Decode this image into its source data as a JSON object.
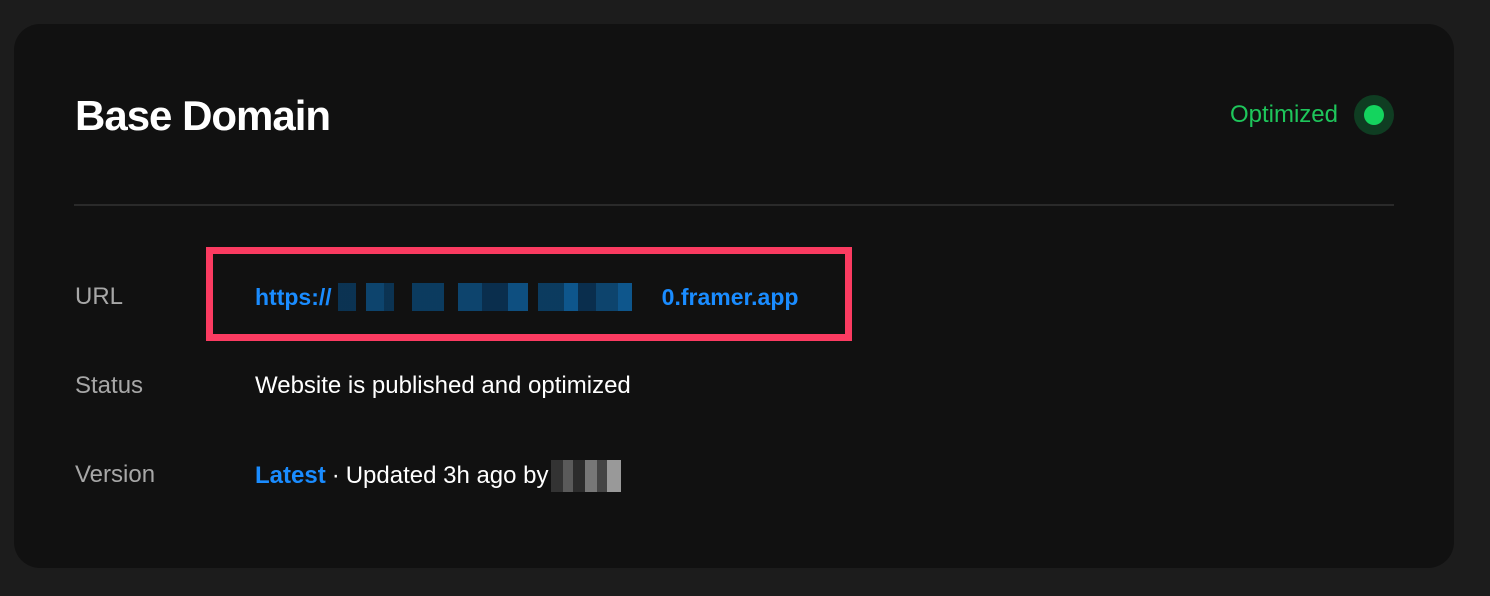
{
  "card": {
    "title": "Base Domain",
    "status": {
      "label": "Optimized",
      "color": "#1ec65b",
      "indicator": "green-dot-icon"
    }
  },
  "rows": {
    "url": {
      "label": "URL",
      "prefix": "https://",
      "suffix": "0.framer.app"
    },
    "status": {
      "label": "Status",
      "value": "Website is published and optimized"
    },
    "version": {
      "label": "Version",
      "link": "Latest",
      "separator": "·",
      "updated": "Updated 3h ago by"
    }
  },
  "colors": {
    "link": "#1a8cff",
    "highlight": "#fb3b61",
    "background": "#111111"
  }
}
